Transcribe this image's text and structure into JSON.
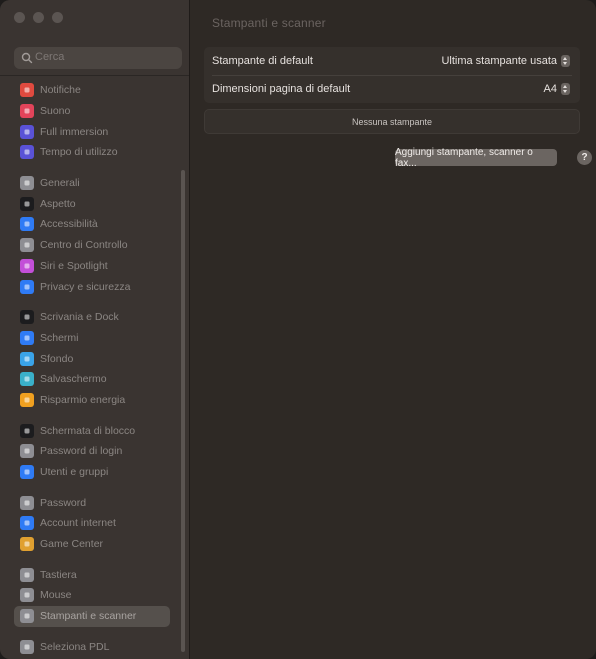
{
  "window": {
    "title": "Stampanti e scanner"
  },
  "search": {
    "placeholder": "Cerca"
  },
  "sidebar": {
    "groups": [
      [
        {
          "label": "Notifiche",
          "icon": "bell-icon",
          "color": "#e04a3f"
        },
        {
          "label": "Suono",
          "icon": "speaker-icon",
          "color": "#e2445a"
        },
        {
          "label": "Full immersion",
          "icon": "moon-icon",
          "color": "#5a52d6"
        },
        {
          "label": "Tempo di utilizzo",
          "icon": "hourglass-icon",
          "color": "#5a52d6"
        }
      ],
      [
        {
          "label": "Generali",
          "icon": "gear-icon",
          "color": "#8e8e93"
        },
        {
          "label": "Aspetto",
          "icon": "appearance-icon",
          "color": "#1c1c1e"
        },
        {
          "label": "Accessibilità",
          "icon": "accessibility-icon",
          "color": "#2f7bf5"
        },
        {
          "label": "Centro di Controllo",
          "icon": "control-center-icon",
          "color": "#8e8e93"
        },
        {
          "label": "Siri e Spotlight",
          "icon": "siri-icon",
          "color": "#c34fd8"
        },
        {
          "label": "Privacy e sicurezza",
          "icon": "hand-icon",
          "color": "#2f7bf5"
        }
      ],
      [
        {
          "label": "Scrivania e Dock",
          "icon": "dock-icon",
          "color": "#1c1c1e"
        },
        {
          "label": "Schermi",
          "icon": "display-icon",
          "color": "#2f7bf5"
        },
        {
          "label": "Sfondo",
          "icon": "wallpaper-icon",
          "color": "#3aa3e8"
        },
        {
          "label": "Salvaschermo",
          "icon": "screensaver-icon",
          "color": "#3ab0c9"
        },
        {
          "label": "Risparmio energia",
          "icon": "battery-icon",
          "color": "#f0a020"
        }
      ],
      [
        {
          "label": "Schermata di blocco",
          "icon": "lock-icon",
          "color": "#1c1c1e"
        },
        {
          "label": "Password di login",
          "icon": "login-password-icon",
          "color": "#8e8e93"
        },
        {
          "label": "Utenti e gruppi",
          "icon": "users-icon",
          "color": "#2f7bf5"
        }
      ],
      [
        {
          "label": "Password",
          "icon": "key-icon",
          "color": "#8e8e93"
        },
        {
          "label": "Account internet",
          "icon": "at-icon",
          "color": "#2f7bf5"
        },
        {
          "label": "Game Center",
          "icon": "game-center-icon",
          "color": "#e0a030"
        }
      ],
      [
        {
          "label": "Tastiera",
          "icon": "keyboard-icon",
          "color": "#8e8e93"
        },
        {
          "label": "Mouse",
          "icon": "mouse-icon",
          "color": "#8e8e93"
        },
        {
          "label": "Stampanti e scanner",
          "icon": "printer-icon",
          "color": "#8e8e93",
          "selected": true
        }
      ],
      [
        {
          "label": "Seleziona PDL",
          "icon": "pdl-icon",
          "color": "#8e8e93"
        }
      ]
    ]
  },
  "main": {
    "rows": [
      {
        "label": "Stampante di default",
        "value": "Ultima stampante usata"
      },
      {
        "label": "Dimensioni pagina di default",
        "value": "A4"
      }
    ],
    "empty_label": "Nessuna stampante",
    "add_button_label": "Aggiungi stampante, scanner o fax...",
    "help_label": "?"
  }
}
